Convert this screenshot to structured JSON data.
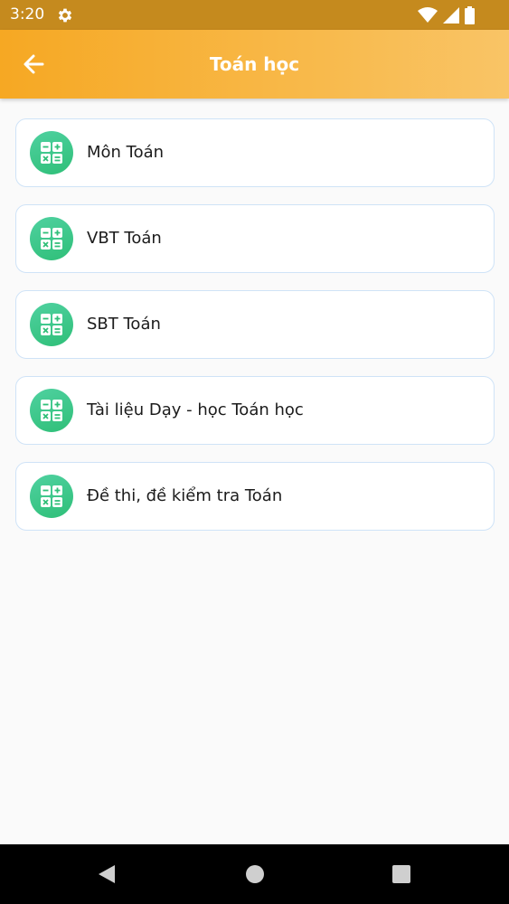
{
  "status_bar": {
    "time": "3:20",
    "icons": [
      "gear-icon",
      "wifi-icon",
      "signal-icon",
      "battery-icon"
    ]
  },
  "app_bar": {
    "title": "Toán học",
    "back_icon": "arrow-left-icon"
  },
  "items": [
    {
      "label": "Môn Toán",
      "icon": "calculator-icon"
    },
    {
      "label": "VBT Toán",
      "icon": "calculator-icon"
    },
    {
      "label": "SBT Toán",
      "icon": "calculator-icon"
    },
    {
      "label": "Tài liệu Dạy - học Toán học",
      "icon": "calculator-icon"
    },
    {
      "label": "Đề thi, đề kiểm tra Toán",
      "icon": "calculator-icon"
    }
  ],
  "nav_bar": {
    "icons": [
      "nav-back-icon",
      "nav-home-icon",
      "nav-recents-icon"
    ]
  },
  "colors": {
    "status_bar": "#c58a1e",
    "app_bar_start": "#f6a823",
    "app_bar_end": "#f9c466",
    "icon_green": "#2fbf78",
    "card_border": "#cfe3f7",
    "background": "#fafafa"
  }
}
